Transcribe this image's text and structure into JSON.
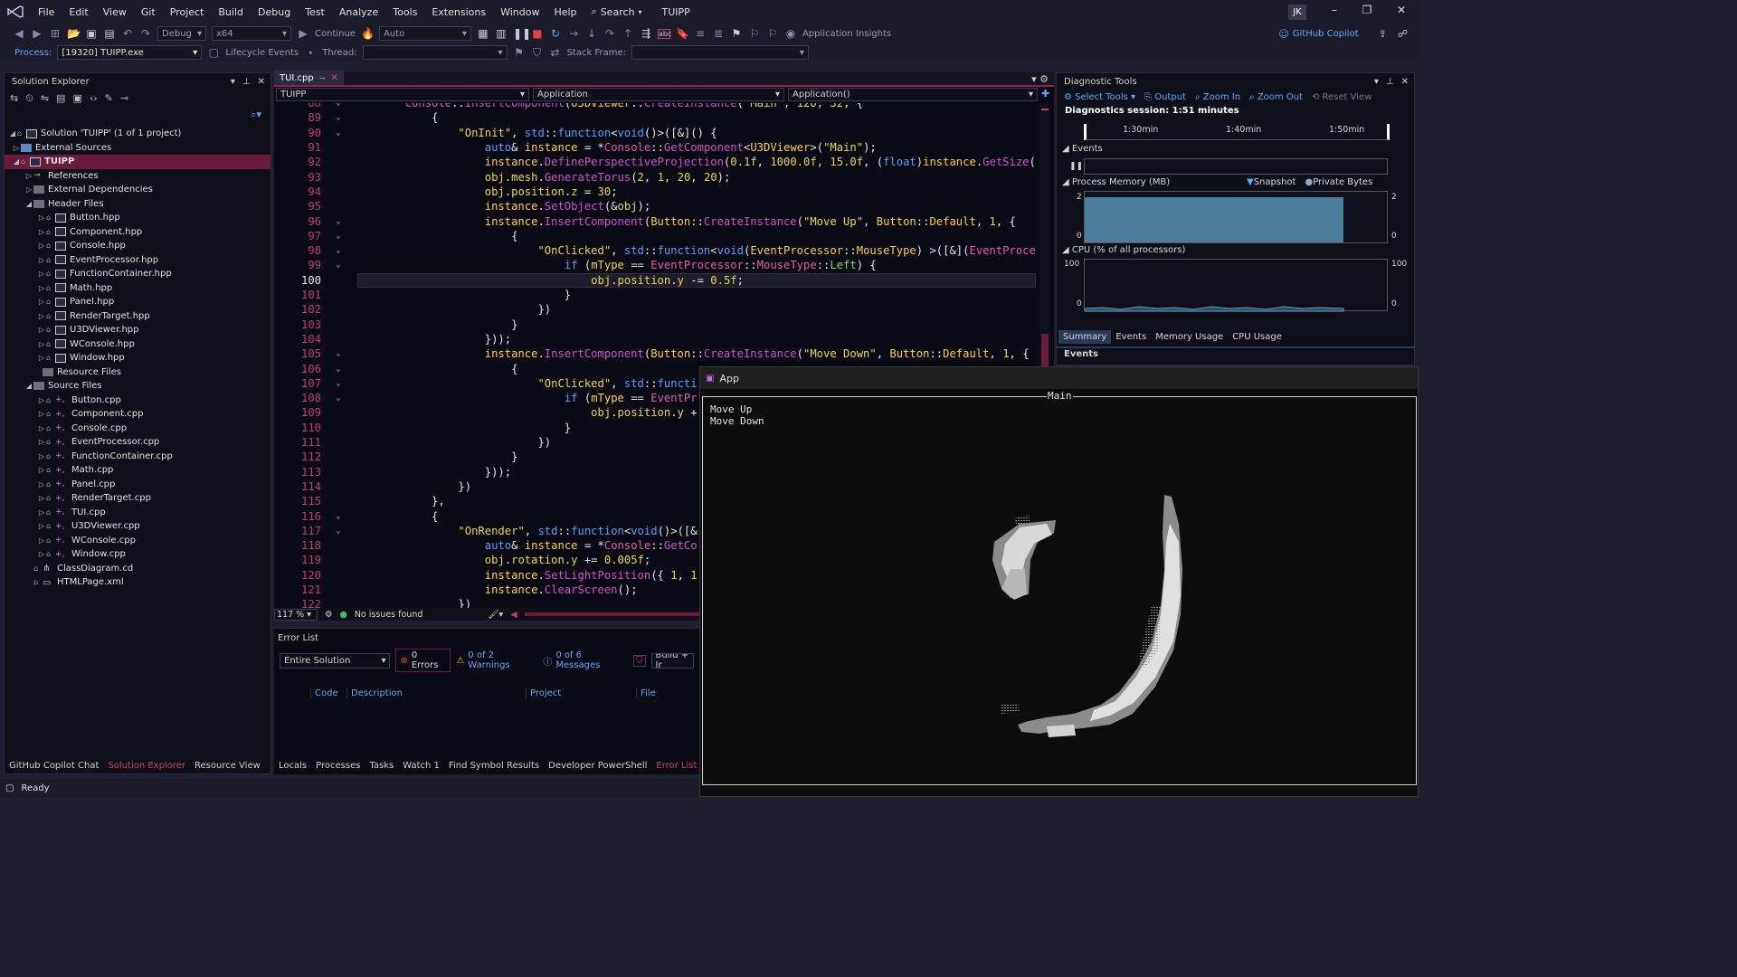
{
  "titlebar": {
    "menu": [
      "File",
      "Edit",
      "View",
      "Git",
      "Project",
      "Build",
      "Debug",
      "Test",
      "Analyze",
      "Tools",
      "Extensions",
      "Window",
      "Help"
    ],
    "search": "Search",
    "project": "TUIPP",
    "user": "JK"
  },
  "toolbar1": {
    "config": "Debug",
    "platform": "x64",
    "continue": "Continue",
    "auto": "Auto",
    "insights": "Application Insights",
    "copilot": "GitHub Copilot"
  },
  "toolbar2": {
    "process_label": "Process:",
    "process_value": "[19320] TUIPP.exe",
    "lifecycle": "Lifecycle Events",
    "thread_label": "Thread:",
    "stackframe_label": "Stack Frame:"
  },
  "solution_explorer": {
    "title": "Solution Explorer",
    "solution": "Solution 'TUIPP' (1 of 1 project)",
    "external_sources": "External Sources",
    "project": "TUIPP",
    "references": "References",
    "external_deps": "External Dependencies",
    "header_files": "Header Files",
    "headers": [
      "Button.hpp",
      "Component.hpp",
      "Console.hpp",
      "EventProcessor.hpp",
      "FunctionContainer.hpp",
      "Math.hpp",
      "Panel.hpp",
      "RenderTarget.hpp",
      "U3DViewer.hpp",
      "WConsole.hpp",
      "Window.hpp"
    ],
    "resource_files": "Resource Files",
    "source_files": "Source Files",
    "sources": [
      "Button.cpp",
      "Component.cpp",
      "Console.cpp",
      "EventProcessor.cpp",
      "FunctionContainer.cpp",
      "Math.cpp",
      "Panel.cpp",
      "RenderTarget.cpp",
      "TUI.cpp",
      "U3DViewer.cpp",
      "WConsole.cpp",
      "Window.cpp"
    ],
    "class_diagram": "ClassDiagram.cd",
    "html_page": "HTMLPage.xml",
    "bottom_tabs": [
      "GitHub Copilot Chat",
      "Solution Explorer",
      "Resource View"
    ]
  },
  "editor": {
    "tab": "TUI.cpp",
    "nav": [
      "TUIPP",
      "Application",
      "Application()"
    ],
    "zoom": "117 %",
    "issues": "No issues found",
    "current_line": "100"
  },
  "error_list": {
    "title": "Error List",
    "scope": "Entire Solution",
    "errors": "0 Errors",
    "warnings": "0 of 2 Warnings",
    "messages": "0 of 6 Messages",
    "build": "Build + Ir",
    "columns": [
      "Code",
      "Description",
      "Project",
      "File"
    ],
    "bottom_tabs": [
      "Locals",
      "Processes",
      "Tasks",
      "Watch 1",
      "Find Symbol Results",
      "Developer PowerShell",
      "Error List"
    ]
  },
  "diagnostic_tools": {
    "title": "Diagnostic Tools",
    "select_tools": "Select Tools",
    "output": "Output",
    "zoom_in": "Zoom In",
    "zoom_out": "Zoom Out",
    "reset_view": "Reset View",
    "session": "Diagnostics session: 1:51 minutes",
    "ticks": [
      "1:30min",
      "1:40min",
      "1:50min"
    ],
    "events_label": "Events",
    "memory_label": "Process Memory (MB)",
    "snapshot": "Snapshot",
    "private_bytes": "Private Bytes",
    "mem_max": "2",
    "mem_min": "0",
    "cpu_label": "CPU (% of all processors)",
    "cpu_max": "100",
    "cpu_min": "0",
    "tabs": [
      "Summary",
      "Events",
      "Memory Usage",
      "CPU Usage"
    ],
    "events_section": "Events"
  },
  "app_window": {
    "title": "App",
    "frame_title": "Main",
    "buttons": [
      "Move Up",
      "Move Down"
    ]
  },
  "status": {
    "text": "Ready"
  },
  "colors": {
    "accent": "#8b2252",
    "link": "#5fa8ff"
  }
}
